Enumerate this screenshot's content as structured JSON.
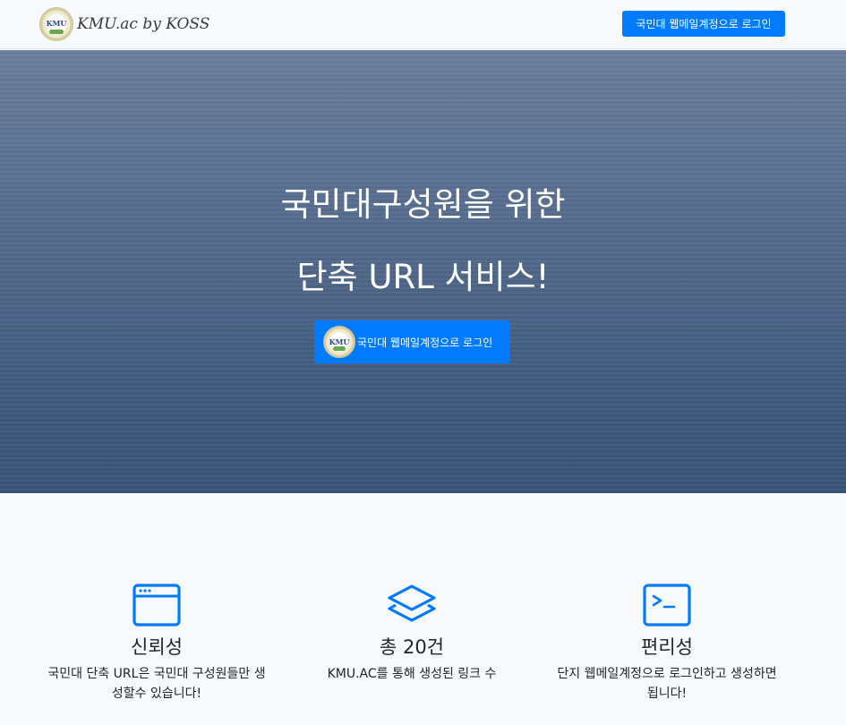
{
  "navbar": {
    "logo_text": "KMU",
    "brand": "KMU.ac by KOSS",
    "login_button": "국민대 웹메일계정으로 로그인"
  },
  "hero": {
    "title_line1": "국민대구성원을 위한",
    "title_line2": "단축 URL 서비스!",
    "login_button": "국민대 웹메일계정으로 로그인"
  },
  "features": [
    {
      "icon": "browser-window-icon",
      "title": "신뢰성",
      "text": "국민대 단축 URL은 국민대 구성원들만 생성할수 있습니다!"
    },
    {
      "icon": "layers-icon",
      "title": "총 20건",
      "text": "KMU.AC를 통해 생성된 링크 수"
    },
    {
      "icon": "terminal-icon",
      "title": "편리성",
      "text": "단지 웹메일계정으로 로그인하고 생성하면 됩니다!"
    }
  ],
  "colors": {
    "primary": "#007bff",
    "hero_bg": "#4d6587",
    "page_bg": "#f8f9fa"
  }
}
